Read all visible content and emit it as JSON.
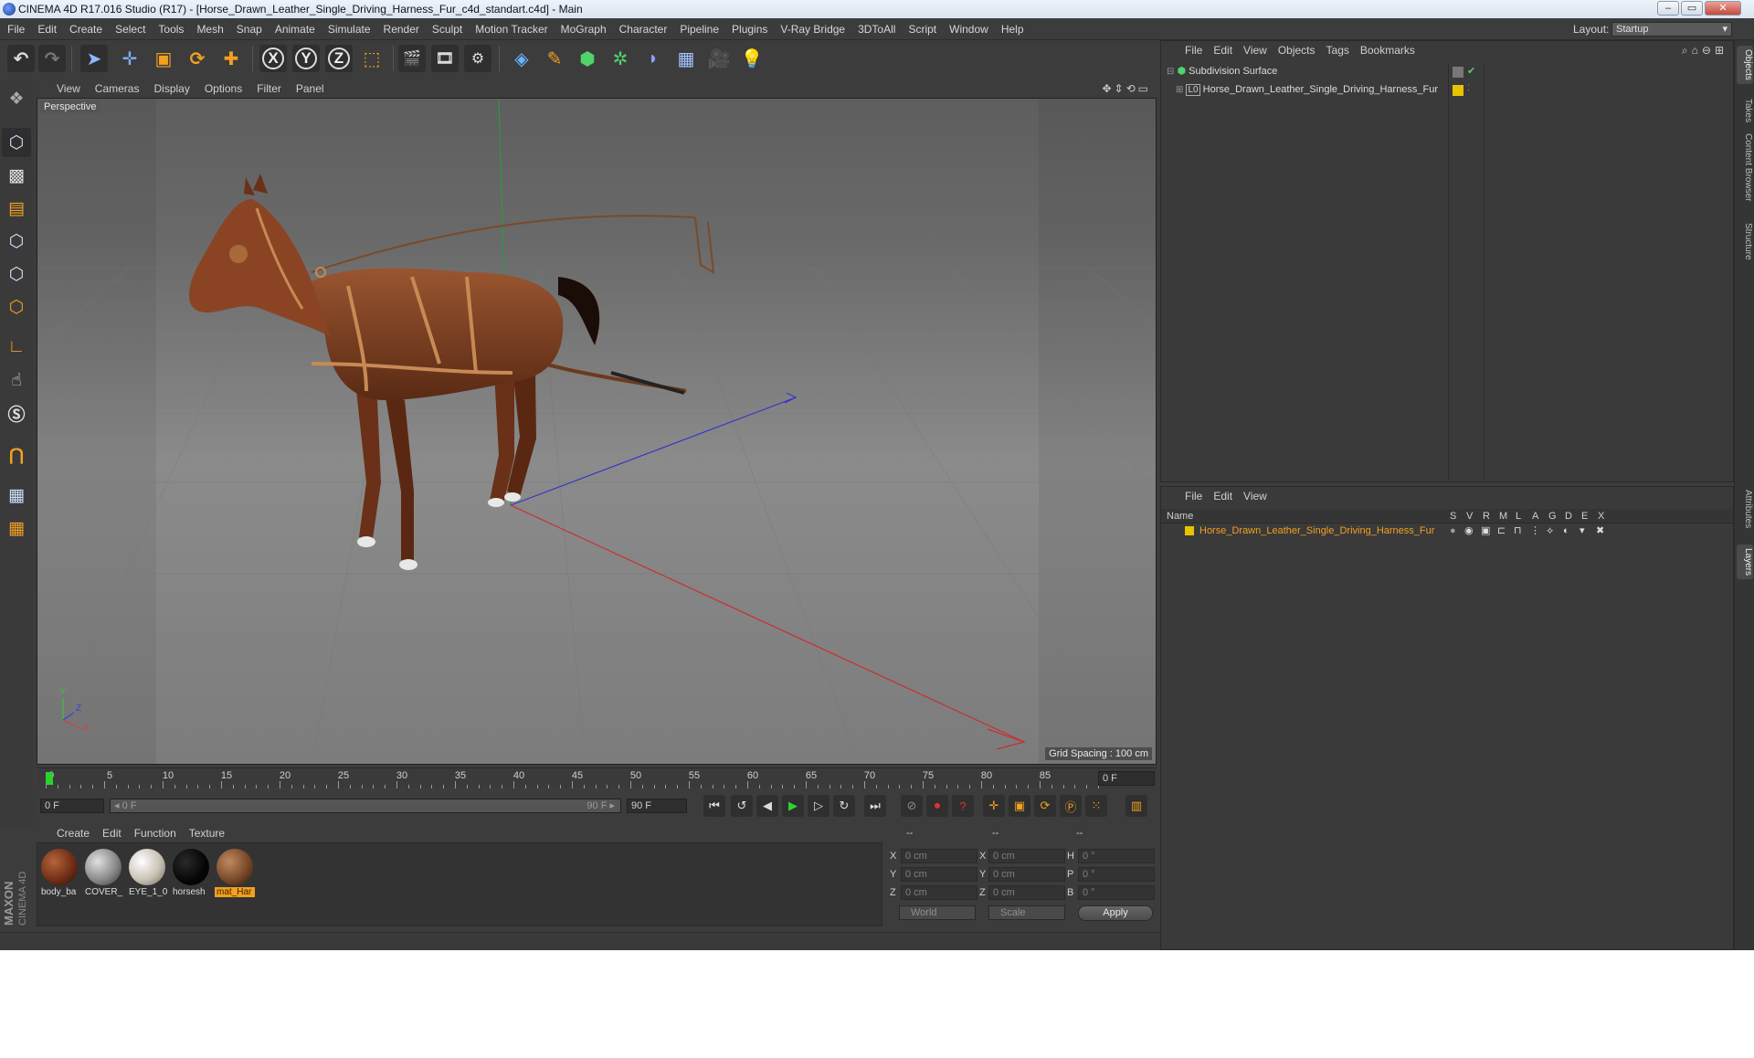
{
  "window": {
    "title": "CINEMA 4D R17.016 Studio (R17) - [Horse_Drawn_Leather_Single_Driving_Harness_Fur_c4d_standart.c4d] - Main",
    "min_icon": "minimize-icon",
    "max_icon": "maximize-icon",
    "close_icon": "close-icon"
  },
  "menubar": {
    "items": [
      "File",
      "Edit",
      "Create",
      "Select",
      "Tools",
      "Mesh",
      "Snap",
      "Animate",
      "Simulate",
      "Render",
      "Sculpt",
      "Motion Tracker",
      "MoGraph",
      "Character",
      "Pipeline",
      "Plugins",
      "V-Ray Bridge",
      "3DToAll",
      "Script",
      "Window",
      "Help"
    ],
    "layout_label": "Layout:",
    "layout_value": "Startup"
  },
  "toolbar": {
    "axis_x": "X",
    "axis_y": "Y",
    "axis_z": "Z"
  },
  "viewport": {
    "menu": [
      "View",
      "Cameras",
      "Display",
      "Options",
      "Filter",
      "Panel"
    ],
    "label": "Perspective",
    "grid_spacing": "Grid Spacing : 100 cm",
    "axis_y_label": "Y",
    "axis_x_label": "X",
    "axis_z_label": "Z"
  },
  "timeline": {
    "ticks": [
      "0",
      "5",
      "10",
      "15",
      "20",
      "25",
      "30",
      "35",
      "40",
      "45",
      "50",
      "55",
      "60",
      "65",
      "70",
      "75",
      "80",
      "85",
      "90"
    ],
    "current_frame": "0 F"
  },
  "transport": {
    "start_field": "0 F",
    "range_start": "◂ 0 F",
    "range_end": "90 F ▸",
    "end_field": "90 F"
  },
  "materials": {
    "menu": [
      "Create",
      "Edit",
      "Function",
      "Texture"
    ],
    "items": [
      {
        "name": "body_ba",
        "color": "#6b2a14"
      },
      {
        "name": "COVER_",
        "color": "#8a8a8a"
      },
      {
        "name": "EYE_1_0",
        "color": "#c9c2b5"
      },
      {
        "name": "horsesh",
        "color": "#050505"
      },
      {
        "name": "mat_Har",
        "color": "#7a4a2a"
      }
    ],
    "selected": "mat_Har"
  },
  "coordinates": {
    "header_1": "--",
    "header_2": "--",
    "header_3": "--",
    "x_label": "X",
    "y_label": "Y",
    "z_label": "Z",
    "h_label": "H",
    "p_label": "P",
    "b_label": "B",
    "pos_x": "0 cm",
    "pos_y": "0 cm",
    "pos_z": "0 cm",
    "size_x": "0 cm",
    "size_y": "0 cm",
    "size_z": "0 cm",
    "rot_h": "0 °",
    "rot_p": "0 °",
    "rot_b": "0 °",
    "mode_select": "World",
    "scale_select": "Scale",
    "apply": "Apply"
  },
  "object_manager": {
    "menu": [
      "File",
      "Edit",
      "View",
      "Objects",
      "Tags",
      "Bookmarks"
    ],
    "objects": [
      {
        "name": "Subdivision Surface"
      },
      {
        "name": "Horse_Drawn_Leather_Single_Driving_Harness_Fur"
      }
    ]
  },
  "layer_manager": {
    "menu": [
      "File",
      "Edit",
      "View"
    ],
    "columns": [
      "Name",
      "S",
      "V",
      "R",
      "M",
      "L",
      "A",
      "G",
      "D",
      "E",
      "X"
    ],
    "layer_name": "Horse_Drawn_Leather_Single_Driving_Harness_Fur"
  },
  "side_tabs": [
    "Objects",
    "Takes",
    "Content Browser",
    "Structure",
    "Attributes",
    "Layers"
  ],
  "colors": {
    "accent": "#f2a020",
    "layer_color": "#e6c400",
    "bg": "#3c3c3c"
  }
}
